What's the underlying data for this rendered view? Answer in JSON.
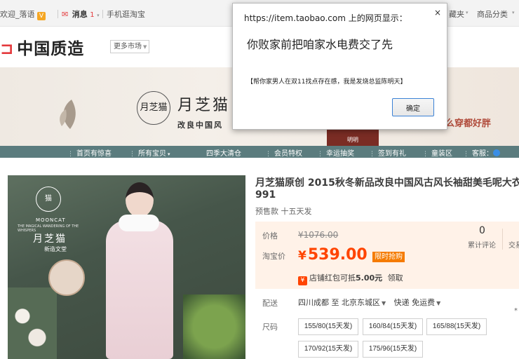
{
  "topbar": {
    "user": "欢迎_落语",
    "messages_label": "消息",
    "messages_count": "1",
    "mobile_taobao": "手机逛淘宝",
    "favorites": "藏夹",
    "categories": "商品分类"
  },
  "header": {
    "logo_text": "中国质造",
    "more_markets": "更多市场"
  },
  "banner": {
    "brand_circle": "月芝猫",
    "brand_name": "月芝猫",
    "slogan": "改良中国风",
    "right_text": "怎么穿都好胖",
    "badge_text": "明明"
  },
  "nav": {
    "items": [
      "首页有惊喜",
      "所有宝贝",
      "四季大清仓",
      "会员特权",
      "幸运抽奖",
      "签到有礼",
      "童装区",
      "客服："
    ]
  },
  "product_image": {
    "brand": "月芝猫",
    "brand_en": "MOONCAT",
    "tagline": "THE MAGICAL WANDERING OF THE WHISPERS",
    "sub": "新造文堂"
  },
  "product": {
    "title_line1": "月芝猫原创 2015秋冬新品改良中国风古风长袖甜美毛呢大衣女",
    "title_line2": "991",
    "presale": "预售款 十五天发",
    "price_label": "价格",
    "original_price": "¥1076.00",
    "taobao_price_label": "淘宝价",
    "sale_price_symbol": "¥",
    "sale_price": "539.00",
    "limit_tag": "限时抢购",
    "review_count": "0",
    "review_label": "累计评论",
    "trade_label": "交易",
    "coupon_icon": "¥",
    "coupon_text": "店铺红包可抵",
    "coupon_amount": "5.00元",
    "coupon_action": "领取",
    "shipping_label": "配送",
    "ship_from": "四川成都",
    "ship_to_word": "至",
    "ship_to": "北京东城区",
    "delivery": "快递 免运费",
    "size_label": "尺码",
    "sizes": [
      "155/80(15天发)",
      "160/84(15天发)",
      "165/88(15天发)",
      "170/92(15天发)",
      "175/96(15天发)"
    ]
  },
  "dialog": {
    "title": "https://item.taobao.com 上的网页显示：",
    "message": "你败家前把咱家水电费交了先",
    "sub_message": "【帮你家男人在双11找点存在感，我是发烧总监陈明天】",
    "ok_label": "确定",
    "close_label": "×"
  },
  "colors": {
    "price": "#ff4400",
    "nav_bar": "#5b7c7e",
    "limit_tag": "#f57b00"
  }
}
